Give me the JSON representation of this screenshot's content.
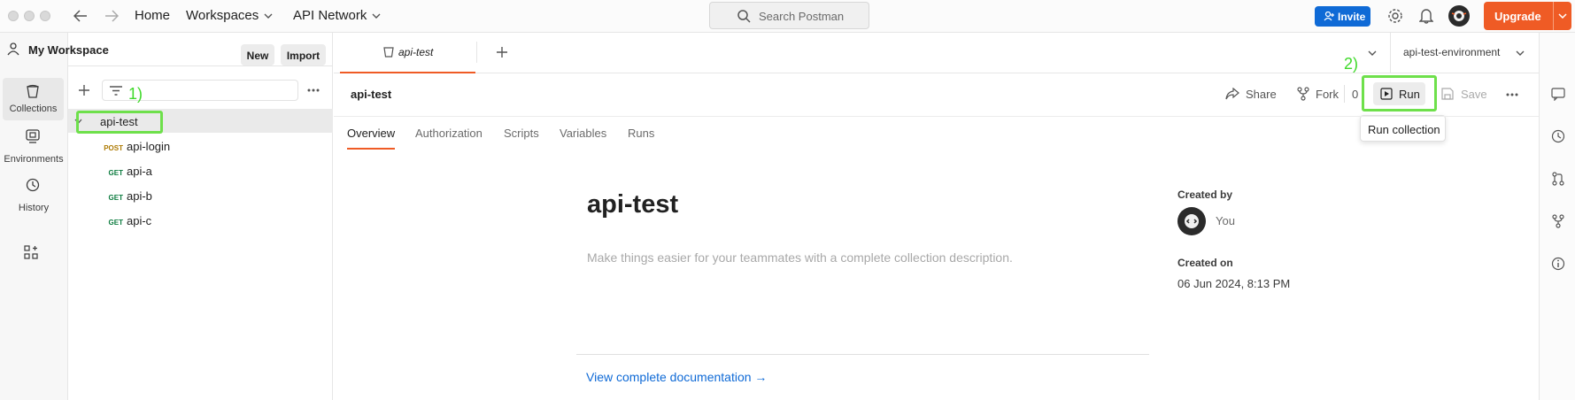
{
  "topbar": {
    "nav": {
      "home": "Home",
      "workspaces": "Workspaces",
      "api_network": "API Network"
    },
    "search_placeholder": "Search Postman",
    "invite_label": "Invite",
    "upgrade_label": "Upgrade"
  },
  "rail": {
    "items": [
      {
        "label": "Collections",
        "icon": "collections-icon"
      },
      {
        "label": "Environments",
        "icon": "environments-icon"
      },
      {
        "label": "History",
        "icon": "history-icon"
      }
    ]
  },
  "sidebar": {
    "workspace_name": "My Workspace",
    "new_label": "New",
    "import_label": "Import",
    "collection_name": "api-test",
    "requests": [
      {
        "method": "POST",
        "name": "api-login"
      },
      {
        "method": "GET",
        "name": "api-a"
      },
      {
        "method": "GET",
        "name": "api-b"
      },
      {
        "method": "GET",
        "name": "api-c"
      }
    ]
  },
  "tabbar": {
    "open_tab": "api-test",
    "environment": "api-test-environment"
  },
  "collection_header": {
    "title": "api-test",
    "share_label": "Share",
    "fork_label": "Fork",
    "fork_count": "0",
    "run_label": "Run",
    "save_label": "Save",
    "tooltip": "Run collection"
  },
  "tabs": [
    "Overview",
    "Authorization",
    "Scripts",
    "Variables",
    "Runs"
  ],
  "overview": {
    "title": "api-test",
    "description_placeholder": "Make things easier for your teammates with a complete collection description.",
    "created_by_label": "Created by",
    "created_by_value": "You",
    "created_on_label": "Created on",
    "created_on_value": "06 Jun 2024, 8:13 PM",
    "docs_link": "View complete documentation →"
  },
  "annotations": {
    "step1": "1)",
    "step2": "2)"
  },
  "colors": {
    "accent_orange": "#ef5b25",
    "invite_blue": "#0f6ad6",
    "highlight_green": "#6ee04b",
    "link_blue": "#0f6ad6"
  }
}
